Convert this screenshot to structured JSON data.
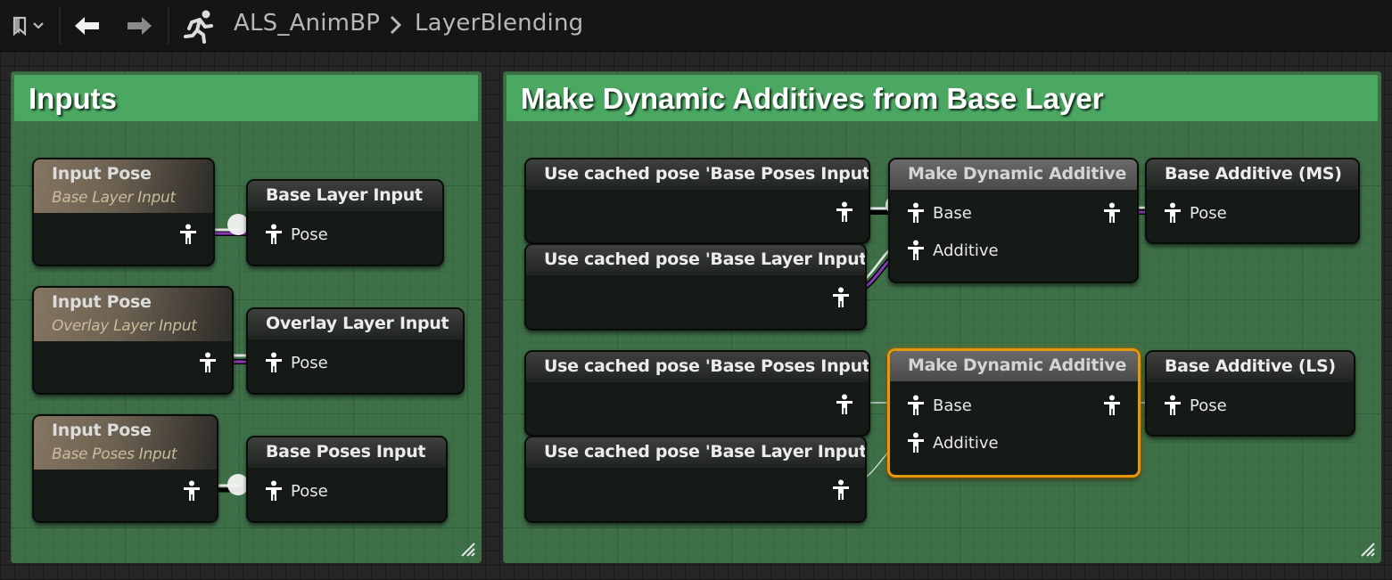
{
  "toolbar": {
    "bookmark_icon": "bookmark-icon",
    "back_icon": "arrow-left-icon",
    "forward_icon": "arrow-right-icon",
    "anim_icon": "running-figure-icon"
  },
  "breadcrumb": {
    "root": "ALS_AnimBP",
    "current": "LayerBlending"
  },
  "comments": {
    "inputs": {
      "title": "Inputs"
    },
    "additives": {
      "title": "Make Dynamic Additives from Base Layer"
    }
  },
  "nodes": {
    "input_pose_1": {
      "title": "Input Pose",
      "subtitle": "Base Layer Input"
    },
    "input_pose_2": {
      "title": "Input Pose",
      "subtitle": "Overlay Layer Input"
    },
    "input_pose_3": {
      "title": "Input Pose",
      "subtitle": "Base Poses Input"
    },
    "save_base_layer": {
      "title": "Base Layer Input",
      "pin": "Pose"
    },
    "save_overlay_layer": {
      "title": "Overlay Layer Input",
      "pin": "Pose"
    },
    "save_base_poses": {
      "title": "Base Poses Input",
      "pin": "Pose"
    },
    "cached_1": {
      "title": "Use cached pose 'Base Poses Input'"
    },
    "cached_2": {
      "title": "Use cached pose 'Base Layer Input'"
    },
    "cached_3": {
      "title": "Use cached pose 'Base Poses Input'"
    },
    "cached_4": {
      "title": "Use cached pose 'Base Layer Input'"
    },
    "mda_1": {
      "title": "Make Dynamic Additive",
      "pin_base": "Base",
      "pin_additive": "Additive"
    },
    "mda_2": {
      "title": "Make Dynamic Additive",
      "pin_base": "Base",
      "pin_additive": "Additive"
    },
    "save_additive_ms": {
      "title": "Base Additive (MS)",
      "pin": "Pose"
    },
    "save_additive_ls": {
      "title": "Base Additive (LS)",
      "pin": "Pose"
    }
  },
  "colors": {
    "comment_header": "#4aa862",
    "comment_body": "#3e7048",
    "selection": "#e8960a",
    "wire_purple": "#8a3bb8",
    "wire_white": "#e6e6e6"
  }
}
